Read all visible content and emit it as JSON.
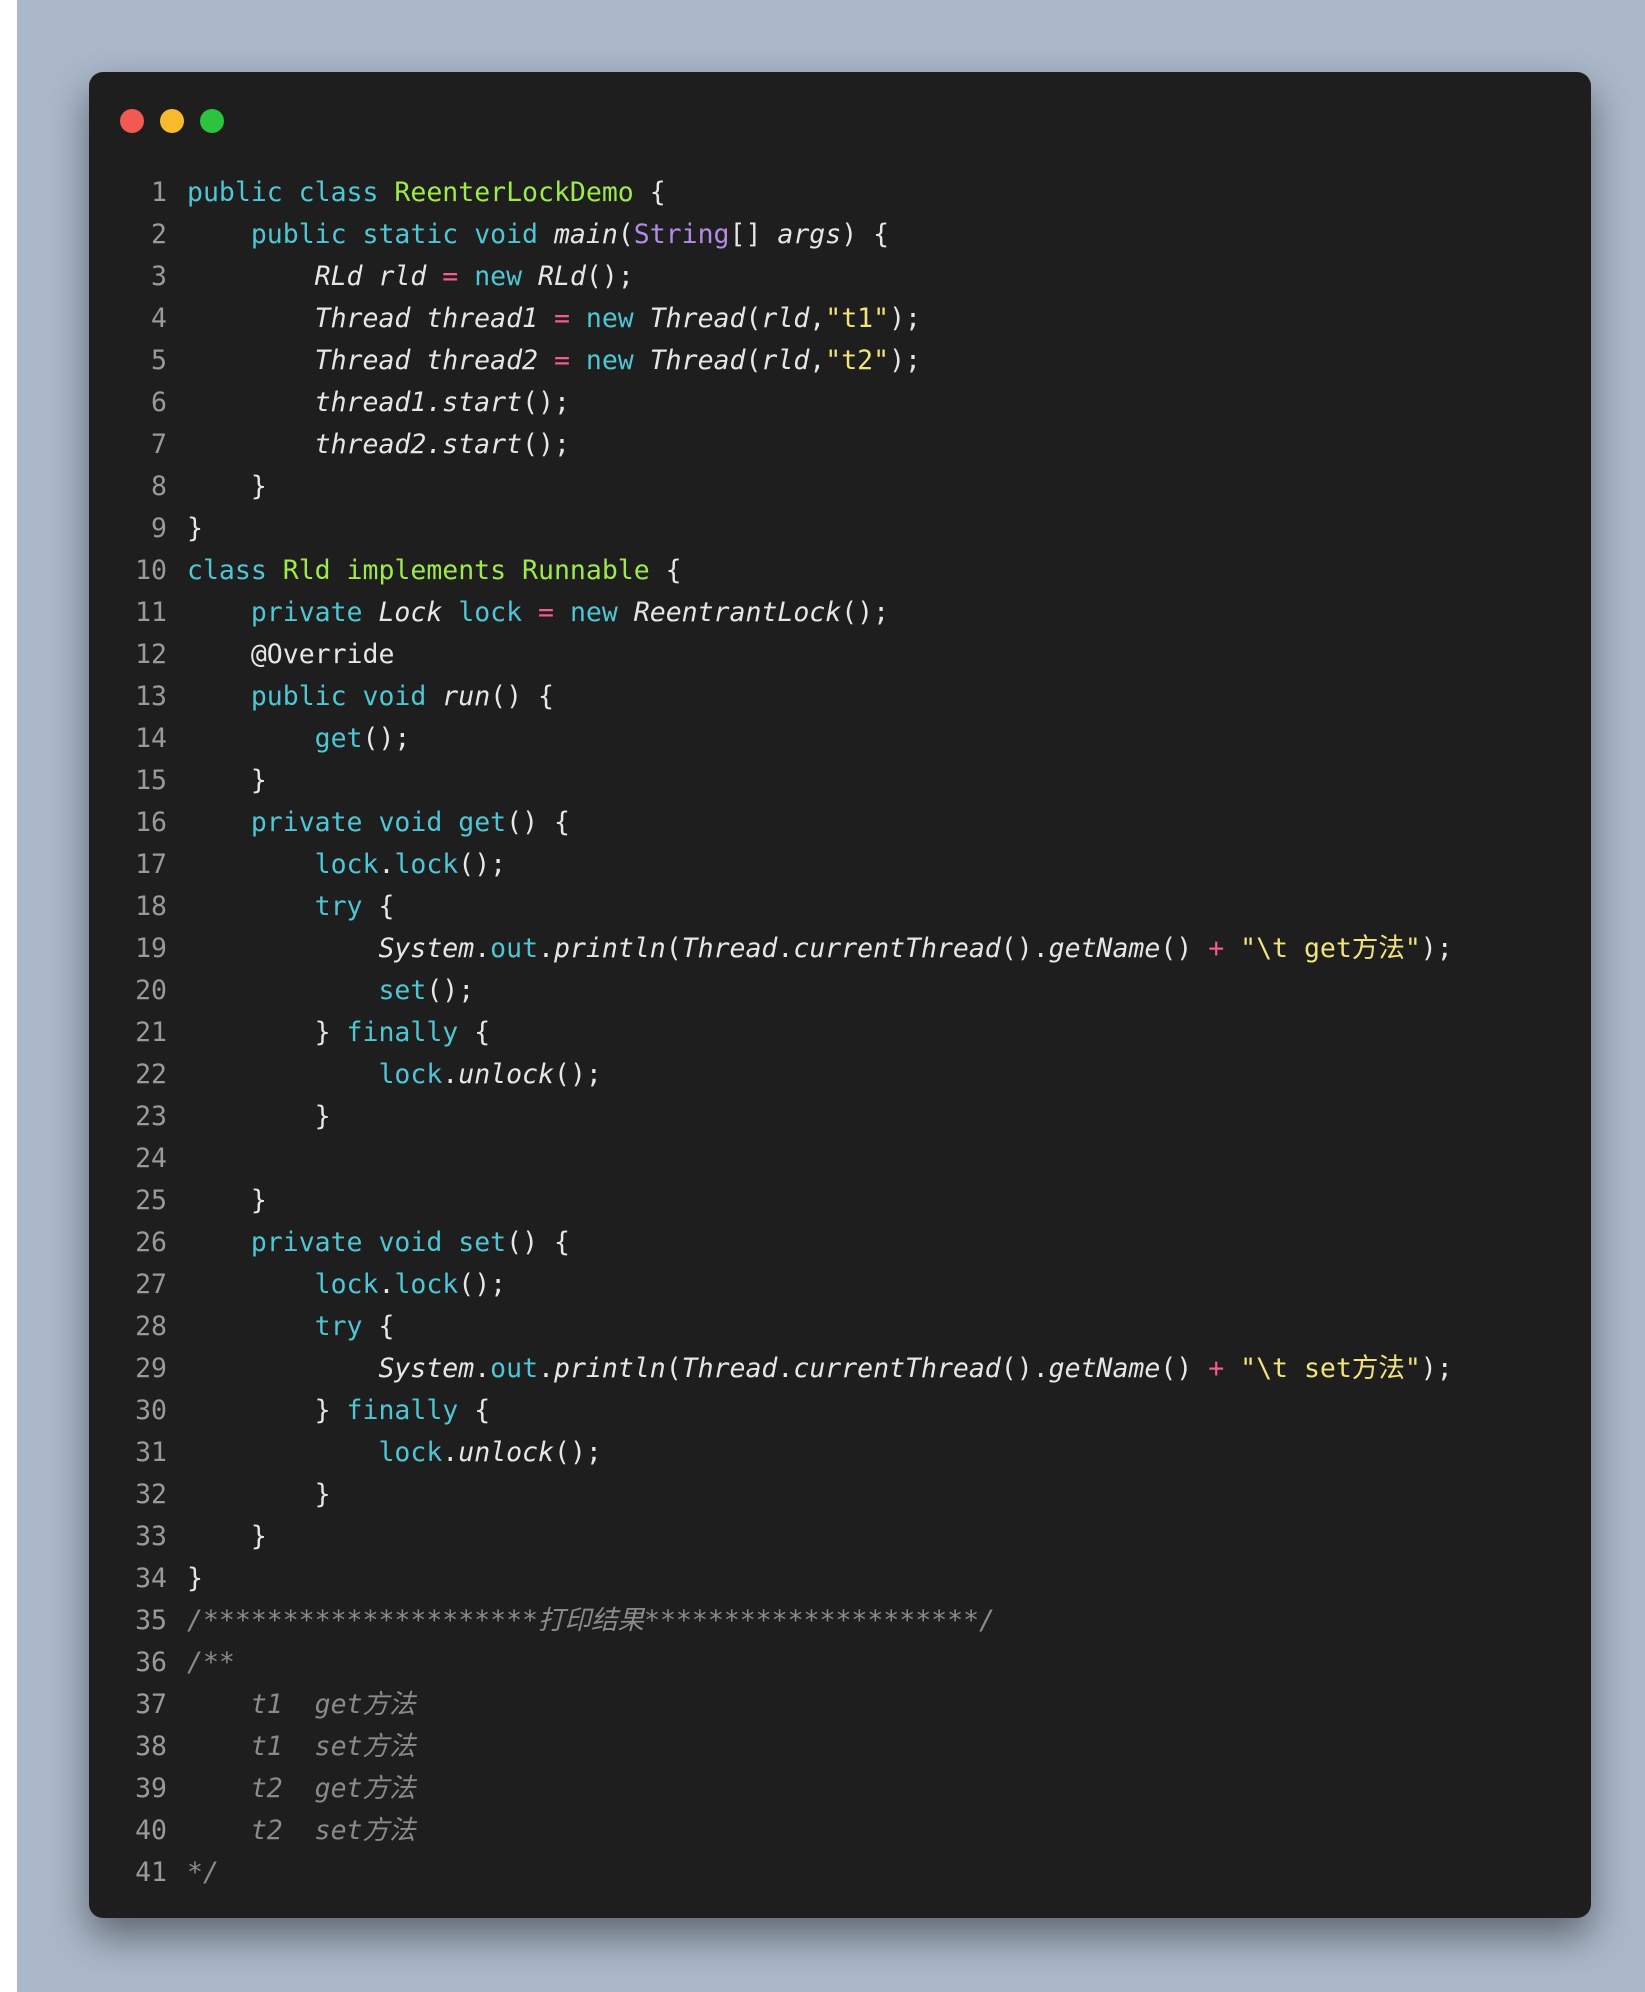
{
  "window": {
    "controls": [
      {
        "name": "close",
        "color": "#f05a52"
      },
      {
        "name": "minimize",
        "color": "#f5bb2d"
      },
      {
        "name": "maximize",
        "color": "#2cc43f"
      }
    ]
  },
  "code": {
    "lines": [
      {
        "n": "1",
        "t": [
          [
            "kw",
            "public class "
          ],
          [
            "cls",
            "ReenterLockDemo"
          ],
          [
            "p",
            " {"
          ]
        ]
      },
      {
        "n": "2",
        "t": [
          [
            "p",
            "    "
          ],
          [
            "kw",
            "public static void "
          ],
          [
            "it",
            "main"
          ],
          [
            "p",
            "("
          ],
          [
            "typ",
            "String"
          ],
          [
            "p",
            "[] "
          ],
          [
            "it",
            "args"
          ],
          [
            "p",
            ") {"
          ]
        ]
      },
      {
        "n": "3",
        "t": [
          [
            "p",
            "        "
          ],
          [
            "it",
            "RLd rld "
          ],
          [
            "op",
            "= "
          ],
          [
            "kw",
            "new "
          ],
          [
            "it",
            "RLd"
          ],
          [
            "p",
            "();"
          ]
        ]
      },
      {
        "n": "4",
        "t": [
          [
            "p",
            "        "
          ],
          [
            "it",
            "Thread thread1 "
          ],
          [
            "op",
            "= "
          ],
          [
            "kw",
            "new "
          ],
          [
            "it",
            "Thread"
          ],
          [
            "p",
            "("
          ],
          [
            "it",
            "rld"
          ],
          [
            "p",
            ","
          ],
          [
            "str",
            "\"t1\""
          ],
          [
            "p",
            ");"
          ]
        ]
      },
      {
        "n": "5",
        "t": [
          [
            "p",
            "        "
          ],
          [
            "it",
            "Thread thread2 "
          ],
          [
            "op",
            "= "
          ],
          [
            "kw",
            "new "
          ],
          [
            "it",
            "Thread"
          ],
          [
            "p",
            "("
          ],
          [
            "it",
            "rld"
          ],
          [
            "p",
            ","
          ],
          [
            "str",
            "\"t2\""
          ],
          [
            "p",
            ");"
          ]
        ]
      },
      {
        "n": "6",
        "t": [
          [
            "p",
            "        "
          ],
          [
            "it",
            "thread1.start"
          ],
          [
            "p",
            "();"
          ]
        ]
      },
      {
        "n": "7",
        "t": [
          [
            "p",
            "        "
          ],
          [
            "it",
            "thread2.start"
          ],
          [
            "p",
            "();"
          ]
        ]
      },
      {
        "n": "8",
        "t": [
          [
            "p",
            "    }"
          ]
        ]
      },
      {
        "n": "9",
        "t": [
          [
            "p",
            "}"
          ]
        ]
      },
      {
        "n": "10",
        "t": [
          [
            "kw",
            "class "
          ],
          [
            "cls",
            "Rld implements Runnable"
          ],
          [
            "p",
            " {"
          ]
        ]
      },
      {
        "n": "11",
        "t": [
          [
            "p",
            "    "
          ],
          [
            "kw",
            "private "
          ],
          [
            "it",
            "Lock "
          ],
          [
            "kw",
            "lock "
          ],
          [
            "op",
            "= "
          ],
          [
            "kw",
            "new "
          ],
          [
            "it",
            "ReentrantLock"
          ],
          [
            "p",
            "();"
          ]
        ]
      },
      {
        "n": "12",
        "t": [
          [
            "p",
            "    "
          ],
          [
            "ann",
            "@Override"
          ]
        ]
      },
      {
        "n": "13",
        "t": [
          [
            "p",
            "    "
          ],
          [
            "kw",
            "public void "
          ],
          [
            "it",
            "run"
          ],
          [
            "p",
            "() {"
          ]
        ]
      },
      {
        "n": "14",
        "t": [
          [
            "p",
            "        "
          ],
          [
            "kw",
            "get"
          ],
          [
            "p",
            "();"
          ]
        ]
      },
      {
        "n": "15",
        "t": [
          [
            "p",
            "    }"
          ]
        ]
      },
      {
        "n": "16",
        "t": [
          [
            "p",
            "    "
          ],
          [
            "kw",
            "private void get"
          ],
          [
            "p",
            "() {"
          ]
        ]
      },
      {
        "n": "17",
        "t": [
          [
            "p",
            "        "
          ],
          [
            "kw",
            "lock"
          ],
          [
            "p",
            "."
          ],
          [
            "kw",
            "lock"
          ],
          [
            "p",
            "();"
          ]
        ]
      },
      {
        "n": "18",
        "t": [
          [
            "p",
            "        "
          ],
          [
            "kw",
            "try"
          ],
          [
            "p",
            " {"
          ]
        ]
      },
      {
        "n": "19",
        "t": [
          [
            "p",
            "            "
          ],
          [
            "it",
            "System"
          ],
          [
            "p",
            "."
          ],
          [
            "kw",
            "out"
          ],
          [
            "p",
            "."
          ],
          [
            "it",
            "println"
          ],
          [
            "p",
            "("
          ],
          [
            "it",
            "Thread"
          ],
          [
            "p",
            "."
          ],
          [
            "it",
            "currentThread"
          ],
          [
            "p",
            "()."
          ],
          [
            "it",
            "getName"
          ],
          [
            "p",
            "() "
          ],
          [
            "op",
            "+ "
          ],
          [
            "str",
            "\"\\t get方法\""
          ],
          [
            "p",
            ");"
          ]
        ]
      },
      {
        "n": "20",
        "t": [
          [
            "p",
            "            "
          ],
          [
            "kw",
            "set"
          ],
          [
            "p",
            "();"
          ]
        ]
      },
      {
        "n": "21",
        "t": [
          [
            "p",
            "        } "
          ],
          [
            "kw",
            "finally"
          ],
          [
            "p",
            " {"
          ]
        ]
      },
      {
        "n": "22",
        "t": [
          [
            "p",
            "            "
          ],
          [
            "kw",
            "lock"
          ],
          [
            "p",
            "."
          ],
          [
            "it",
            "unlock"
          ],
          [
            "p",
            "();"
          ]
        ]
      },
      {
        "n": "23",
        "t": [
          [
            "p",
            "        }"
          ]
        ]
      },
      {
        "n": "24",
        "t": [
          [
            "p",
            ""
          ]
        ]
      },
      {
        "n": "25",
        "t": [
          [
            "p",
            "    }"
          ]
        ]
      },
      {
        "n": "26",
        "t": [
          [
            "p",
            "    "
          ],
          [
            "kw",
            "private void set"
          ],
          [
            "p",
            "() {"
          ]
        ]
      },
      {
        "n": "27",
        "t": [
          [
            "p",
            "        "
          ],
          [
            "kw",
            "lock"
          ],
          [
            "p",
            "."
          ],
          [
            "kw",
            "lock"
          ],
          [
            "p",
            "();"
          ]
        ]
      },
      {
        "n": "28",
        "t": [
          [
            "p",
            "        "
          ],
          [
            "kw",
            "try"
          ],
          [
            "p",
            " {"
          ]
        ]
      },
      {
        "n": "29",
        "t": [
          [
            "p",
            "            "
          ],
          [
            "it",
            "System"
          ],
          [
            "p",
            "."
          ],
          [
            "kw",
            "out"
          ],
          [
            "p",
            "."
          ],
          [
            "it",
            "println"
          ],
          [
            "p",
            "("
          ],
          [
            "it",
            "Thread"
          ],
          [
            "p",
            "."
          ],
          [
            "it",
            "currentThread"
          ],
          [
            "p",
            "()."
          ],
          [
            "it",
            "getName"
          ],
          [
            "p",
            "() "
          ],
          [
            "op",
            "+ "
          ],
          [
            "str",
            "\"\\t set方法\""
          ],
          [
            "p",
            ");"
          ]
        ]
      },
      {
        "n": "30",
        "t": [
          [
            "p",
            "        } "
          ],
          [
            "kw",
            "finally"
          ],
          [
            "p",
            " {"
          ]
        ]
      },
      {
        "n": "31",
        "t": [
          [
            "p",
            "            "
          ],
          [
            "kw",
            "lock"
          ],
          [
            "p",
            "."
          ],
          [
            "it",
            "unlock"
          ],
          [
            "p",
            "();"
          ]
        ]
      },
      {
        "n": "32",
        "t": [
          [
            "p",
            "        }"
          ]
        ]
      },
      {
        "n": "33",
        "t": [
          [
            "p",
            "    }"
          ]
        ]
      },
      {
        "n": "34",
        "t": [
          [
            "p",
            "}"
          ]
        ]
      },
      {
        "n": "35",
        "t": [
          [
            "cmt",
            "/*********************打印结果*********************/"
          ]
        ]
      },
      {
        "n": "36",
        "t": [
          [
            "cmt",
            "/**"
          ]
        ]
      },
      {
        "n": "37",
        "t": [
          [
            "cmt",
            "    t1  get方法"
          ]
        ]
      },
      {
        "n": "38",
        "t": [
          [
            "cmt",
            "    t1  set方法"
          ]
        ]
      },
      {
        "n": "39",
        "t": [
          [
            "cmt",
            "    t2  get方法"
          ]
        ]
      },
      {
        "n": "40",
        "t": [
          [
            "cmt",
            "    t2  set方法"
          ]
        ]
      },
      {
        "n": "41",
        "t": [
          [
            "cmt",
            "*/"
          ]
        ]
      }
    ]
  }
}
